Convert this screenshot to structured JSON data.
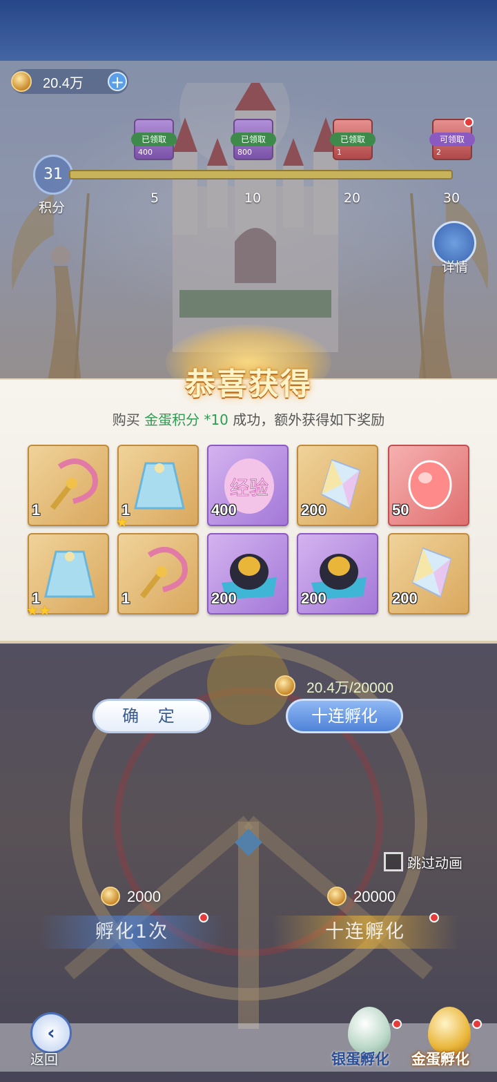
{
  "currency": {
    "value": "20.4万",
    "plus_icon": "plus-icon"
  },
  "points": {
    "value": "31",
    "label": "积分"
  },
  "milestones": [
    {
      "status": "已领取",
      "amount": "400",
      "threshold": "5"
    },
    {
      "status": "已领取",
      "amount": "800",
      "threshold": "10"
    },
    {
      "status": "已领取",
      "amount": "1",
      "threshold": "20"
    },
    {
      "status": "可领取",
      "amount": "2",
      "threshold": "30"
    }
  ],
  "detail": {
    "label": "详情"
  },
  "popup": {
    "title": "恭喜获得",
    "subtitle_prefix": "购买 ",
    "subtitle_highlight": "金蛋积分 *10",
    "subtitle_suffix": " 成功，额外获得如下奖励",
    "items": [
      {
        "icon": "pink-scepter-icon",
        "qty": "1",
        "stars": "",
        "rarity": "gold"
      },
      {
        "icon": "blue-cape-icon",
        "qty": "1",
        "stars": "★",
        "rarity": "gold"
      },
      {
        "icon": "exp-egg-icon",
        "qty": "400",
        "stars": "",
        "rarity": "purple",
        "text": "经验"
      },
      {
        "icon": "rainbow-crystal-icon",
        "qty": "200",
        "stars": "",
        "rarity": "gold"
      },
      {
        "icon": "red-gem-icon",
        "qty": "50",
        "stars": "",
        "rarity": "red"
      },
      {
        "icon": "blue-cape-icon",
        "qty": "1",
        "stars": "★★",
        "rarity": "gold"
      },
      {
        "icon": "pink-scepter-icon",
        "qty": "1",
        "stars": "",
        "rarity": "gold"
      },
      {
        "icon": "golden-egg-nest-icon",
        "qty": "200",
        "stars": "",
        "rarity": "purple"
      },
      {
        "icon": "golden-egg-nest-icon",
        "qty": "200",
        "stars": "",
        "rarity": "purple"
      },
      {
        "icon": "rainbow-crystal-icon",
        "qty": "200",
        "stars": "",
        "rarity": "gold"
      }
    ]
  },
  "actions": {
    "confirm": "确 定",
    "ten_hatch": "十连孵化",
    "cost": "20.4万/20000"
  },
  "skip": {
    "label": "跳过动画"
  },
  "hatch": {
    "single_price": "2000",
    "single_label": "孵化1次",
    "ten_price": "20000",
    "ten_label": "十连孵化"
  },
  "nav": {
    "back": "返回",
    "silver": "银蛋孵化",
    "gold": "金蛋孵化"
  }
}
